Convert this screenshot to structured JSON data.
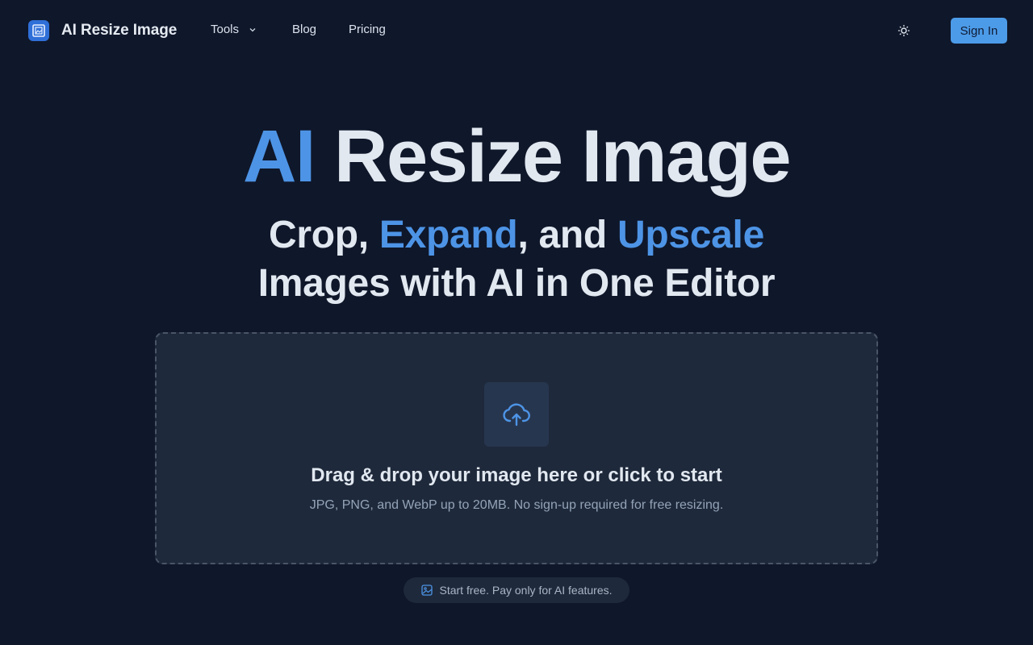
{
  "header": {
    "brand_name": "AI Resize Image",
    "nav": {
      "tools_label": "Tools",
      "blog_label": "Blog",
      "pricing_label": "Pricing"
    },
    "sign_in_label": "Sign In"
  },
  "hero": {
    "title_accent": "AI",
    "title_rest": " Resize Image",
    "sub_line1_a": "Crop, ",
    "sub_line1_b": "Expand",
    "sub_line1_c": ", and ",
    "sub_line1_d": "Upscale",
    "sub_line2": "Images with AI in One Editor"
  },
  "dropzone": {
    "title": "Drag & drop your image here or click to start",
    "subtitle": "JPG, PNG, and WebP up to 20MB. No sign-up required for free resizing."
  },
  "badge": {
    "text": "Start free. Pay only for AI features."
  },
  "colors": {
    "background": "#0f172a",
    "accent": "#4d94e6",
    "button": "#4c9be8",
    "panel": "#1e293b"
  },
  "icons": {
    "logo": "image-frame-icon",
    "tools_chevron": "chevron-down-icon",
    "theme": "sun-icon",
    "upload": "cloud-upload-icon",
    "badge": "image-icon"
  }
}
